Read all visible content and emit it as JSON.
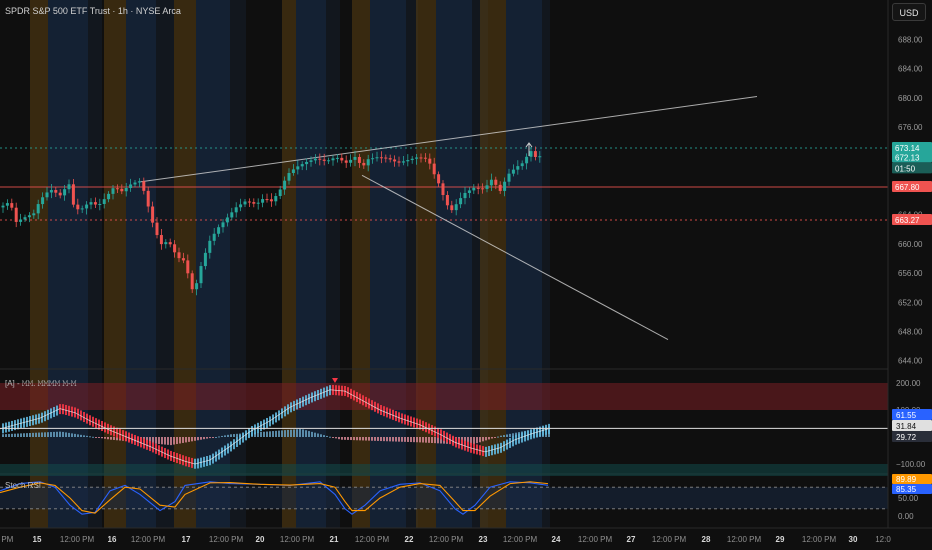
{
  "header": {
    "title": "SPDR S&P 500 ETF Trust · 1h · NYSE Arca",
    "currency_button": "USD"
  },
  "colors": {
    "background": "#0f0f0f",
    "candle_up": "#26a69a",
    "candle_down": "#ef5350",
    "resistance_line": "#e0e0e0",
    "green_level": "#26a69a",
    "red_level": "#ef5350",
    "macd_up": "#5fb4d8",
    "macd_down": "#f23645",
    "stoch_k": "#2962ff",
    "stoch_d": "#ff9800",
    "band_orange": "#6b4a12",
    "band_blue": "#1a3358"
  },
  "panels": {
    "main": {
      "price_ticks": [
        "688.00",
        "684.00",
        "680.00",
        "676.00",
        "672.00",
        "668.00",
        "664.00",
        "660.00",
        "656.00",
        "652.00",
        "648.00",
        "644.00"
      ]
    },
    "macd": {
      "label": "[A] - 𝙼𝙼. 𝙼𝙼𝙼𝙼 𝙼-𝙼",
      "ticks": [
        "200.00",
        "100.00",
        "−100.00"
      ],
      "tags": [
        {
          "text": "61.55",
          "color": "#2962ff"
        },
        {
          "text": "31.84",
          "color": "#e0e0e0",
          "text_color": "#111111"
        },
        {
          "text": "29.72",
          "color": "#2a2e39"
        }
      ]
    },
    "stoch": {
      "label": "Stoch RSI",
      "ticks": [
        "50.00",
        "0.00"
      ],
      "tags": [
        {
          "text": "89.89",
          "color": "#ff9800"
        },
        {
          "text": "85.35",
          "color": "#2962ff"
        }
      ]
    }
  },
  "time_axis": [
    "2 PM",
    "15",
    "12:00 PM",
    "16",
    "12:00 PM",
    "17",
    "12:00 PM",
    "20",
    "12:00 PM",
    "21",
    "12:00 PM",
    "22",
    "12:00 PM",
    "23",
    "12:00 PM",
    "24",
    "12:00 PM",
    "27",
    "12:00 PM",
    "28",
    "12:00 PM",
    "29",
    "12:00 PM",
    "30",
    "12:0"
  ],
  "chart_data": [
    {
      "type": "candlestick",
      "title": "SPDR S&P 500 ETF Trust · 1h · NYSE Arca",
      "x": [
        "Oct 15",
        "Oct 16",
        "Oct 17",
        "Oct 20",
        "Oct 21",
        "Oct 22",
        "Oct 23",
        "Oct 24"
      ],
      "ylim": [
        643,
        690
      ],
      "price_levels": [
        {
          "value": 673.14,
          "label": "673.14",
          "style": "dotted",
          "color": "#26a69a"
        },
        {
          "value": 672.13,
          "label": "672.13",
          "style": "last_price",
          "color": "#26a69a"
        },
        {
          "value": 667.8,
          "label": "667.80",
          "style": "solid",
          "color": "#ef5350"
        },
        {
          "value": 663.27,
          "label": "663.27",
          "style": "dotted",
          "color": "#ef5350"
        }
      ],
      "countdown_label": "01:50",
      "trendlines": [
        {
          "name": "upper",
          "from": [
            140,
            668.5
          ],
          "to": [
            757,
            680.2
          ]
        },
        {
          "name": "lower",
          "from": [
            362,
            669.4
          ],
          "to": [
            668,
            646.9
          ]
        }
      ],
      "close_path": [
        [
          0,
          665.0
        ],
        [
          10,
          665.8
        ],
        [
          16,
          663.0
        ],
        [
          24,
          663.6
        ],
        [
          34,
          664.2
        ],
        [
          40,
          666.0
        ],
        [
          50,
          667.5
        ],
        [
          62,
          666.5
        ],
        [
          68,
          668.8
        ],
        [
          74,
          665.0
        ],
        [
          80,
          664.6
        ],
        [
          90,
          665.8
        ],
        [
          98,
          665.2
        ],
        [
          106,
          666.4
        ],
        [
          114,
          667.8
        ],
        [
          122,
          667.2
        ],
        [
          132,
          668.3
        ],
        [
          140,
          668.6
        ],
        [
          146,
          666.5
        ],
        [
          150,
          664.0
        ],
        [
          156,
          661.5
        ],
        [
          162,
          659.8
        ],
        [
          168,
          660.5
        ],
        [
          176,
          658.5
        ],
        [
          182,
          657.6
        ],
        [
          186,
          658.0
        ],
        [
          190,
          653.5
        ],
        [
          196,
          654.3
        ],
        [
          202,
          657.5
        ],
        [
          210,
          660.5
        ],
        [
          218,
          662.2
        ],
        [
          226,
          663.4
        ],
        [
          236,
          665.0
        ],
        [
          246,
          665.9
        ],
        [
          256,
          665.4
        ],
        [
          264,
          666.3
        ],
        [
          272,
          665.8
        ],
        [
          280,
          667.4
        ],
        [
          288,
          669.6
        ],
        [
          296,
          670.5
        ],
        [
          306,
          671.2
        ],
        [
          316,
          671.7
        ],
        [
          326,
          671.3
        ],
        [
          336,
          671.9
        ],
        [
          346,
          671.1
        ],
        [
          356,
          672.0
        ],
        [
          362,
          670.4
        ],
        [
          368,
          671.6
        ],
        [
          378,
          671.9
        ],
        [
          388,
          671.7
        ],
        [
          398,
          671.1
        ],
        [
          408,
          671.5
        ],
        [
          418,
          671.9
        ],
        [
          428,
          671.6
        ],
        [
          434,
          669.6
        ],
        [
          440,
          667.9
        ],
        [
          446,
          665.5
        ],
        [
          452,
          664.6
        ],
        [
          458,
          665.8
        ],
        [
          464,
          666.9
        ],
        [
          474,
          667.7
        ],
        [
          484,
          667.5
        ],
        [
          492,
          668.9
        ],
        [
          500,
          667.2
        ],
        [
          508,
          669.5
        ],
        [
          516,
          670.5
        ],
        [
          524,
          671.2
        ],
        [
          530,
          672.9
        ],
        [
          536,
          671.8
        ],
        [
          542,
          672.13
        ]
      ]
    },
    {
      "type": "histogram",
      "title": "[A] - 𝙼𝙼. 𝙼𝙼𝙼𝙼 𝙼-𝙼",
      "ylim": [
        -130,
        220
      ],
      "zones": [
        {
          "from": 100,
          "to": 200,
          "label": "200.00"
        }
      ],
      "signal_path": [
        [
          0,
          30
        ],
        [
          20,
          50
        ],
        [
          40,
          70
        ],
        [
          60,
          105
        ],
        [
          75,
          90
        ],
        [
          90,
          60
        ],
        [
          110,
          25
        ],
        [
          130,
          -5
        ],
        [
          150,
          -35
        ],
        [
          170,
          -70
        ],
        [
          185,
          -90
        ],
        [
          195,
          -100
        ],
        [
          210,
          -85
        ],
        [
          230,
          -35
        ],
        [
          250,
          20
        ],
        [
          270,
          60
        ],
        [
          290,
          110
        ],
        [
          310,
          145
        ],
        [
          330,
          175
        ],
        [
          345,
          170
        ],
        [
          360,
          140
        ],
        [
          380,
          100
        ],
        [
          400,
          70
        ],
        [
          420,
          45
        ],
        [
          440,
          10
        ],
        [
          455,
          -20
        ],
        [
          470,
          -40
        ],
        [
          485,
          -55
        ],
        [
          500,
          -40
        ],
        [
          515,
          -10
        ],
        [
          530,
          10
        ],
        [
          548,
          30
        ]
      ],
      "histogram_zero_band": [
        [
          0,
          10
        ],
        [
          60,
          20
        ],
        [
          110,
          -10
        ],
        [
          170,
          -30
        ],
        [
          230,
          10
        ],
        [
          300,
          30
        ],
        [
          340,
          -10
        ],
        [
          420,
          -20
        ],
        [
          470,
          -30
        ],
        [
          500,
          5
        ],
        [
          548,
          40
        ]
      ],
      "hline": 31.84
    },
    {
      "type": "line",
      "title": "Stoch RSI",
      "ylim": [
        -10,
        110
      ],
      "bands": [
        20,
        80
      ],
      "series": [
        {
          "name": "K",
          "color": "#2962ff",
          "values": [
            [
              0,
              70
            ],
            [
              20,
              90
            ],
            [
              40,
              95
            ],
            [
              55,
              80
            ],
            [
              70,
              30
            ],
            [
              82,
              5
            ],
            [
              95,
              10
            ],
            [
              110,
              70
            ],
            [
              125,
              85
            ],
            [
              140,
              60
            ],
            [
              160,
              15
            ],
            [
              175,
              40
            ],
            [
              185,
              85
            ],
            [
              210,
              95
            ],
            [
              230,
              90
            ],
            [
              260,
              88
            ],
            [
              290,
              85
            ],
            [
              320,
              95
            ],
            [
              335,
              60
            ],
            [
              345,
              20
            ],
            [
              352,
              5
            ],
            [
              365,
              30
            ],
            [
              380,
              70
            ],
            [
              400,
              88
            ],
            [
              420,
              92
            ],
            [
              440,
              70
            ],
            [
              455,
              20
            ],
            [
              463,
              5
            ],
            [
              475,
              30
            ],
            [
              490,
              80
            ],
            [
              510,
              95
            ],
            [
              530,
              92
            ],
            [
              548,
              85.35
            ]
          ]
        },
        {
          "name": "D",
          "color": "#ff9800",
          "values": [
            [
              0,
              65
            ],
            [
              20,
              80
            ],
            [
              40,
              92
            ],
            [
              55,
              85
            ],
            [
              70,
              50
            ],
            [
              82,
              15
            ],
            [
              95,
              8
            ],
            [
              110,
              45
            ],
            [
              125,
              80
            ],
            [
              140,
              75
            ],
            [
              160,
              30
            ],
            [
              175,
              25
            ],
            [
              185,
              60
            ],
            [
              210,
              92
            ],
            [
              230,
              93
            ],
            [
              260,
              88
            ],
            [
              290,
              86
            ],
            [
              320,
              90
            ],
            [
              335,
              80
            ],
            [
              345,
              40
            ],
            [
              352,
              15
            ],
            [
              365,
              15
            ],
            [
              380,
              50
            ],
            [
              400,
              80
            ],
            [
              420,
              90
            ],
            [
              440,
              85
            ],
            [
              455,
              40
            ],
            [
              463,
              15
            ],
            [
              475,
              15
            ],
            [
              490,
              55
            ],
            [
              510,
              90
            ],
            [
              530,
              95
            ],
            [
              548,
              89.89
            ]
          ]
        }
      ]
    }
  ]
}
